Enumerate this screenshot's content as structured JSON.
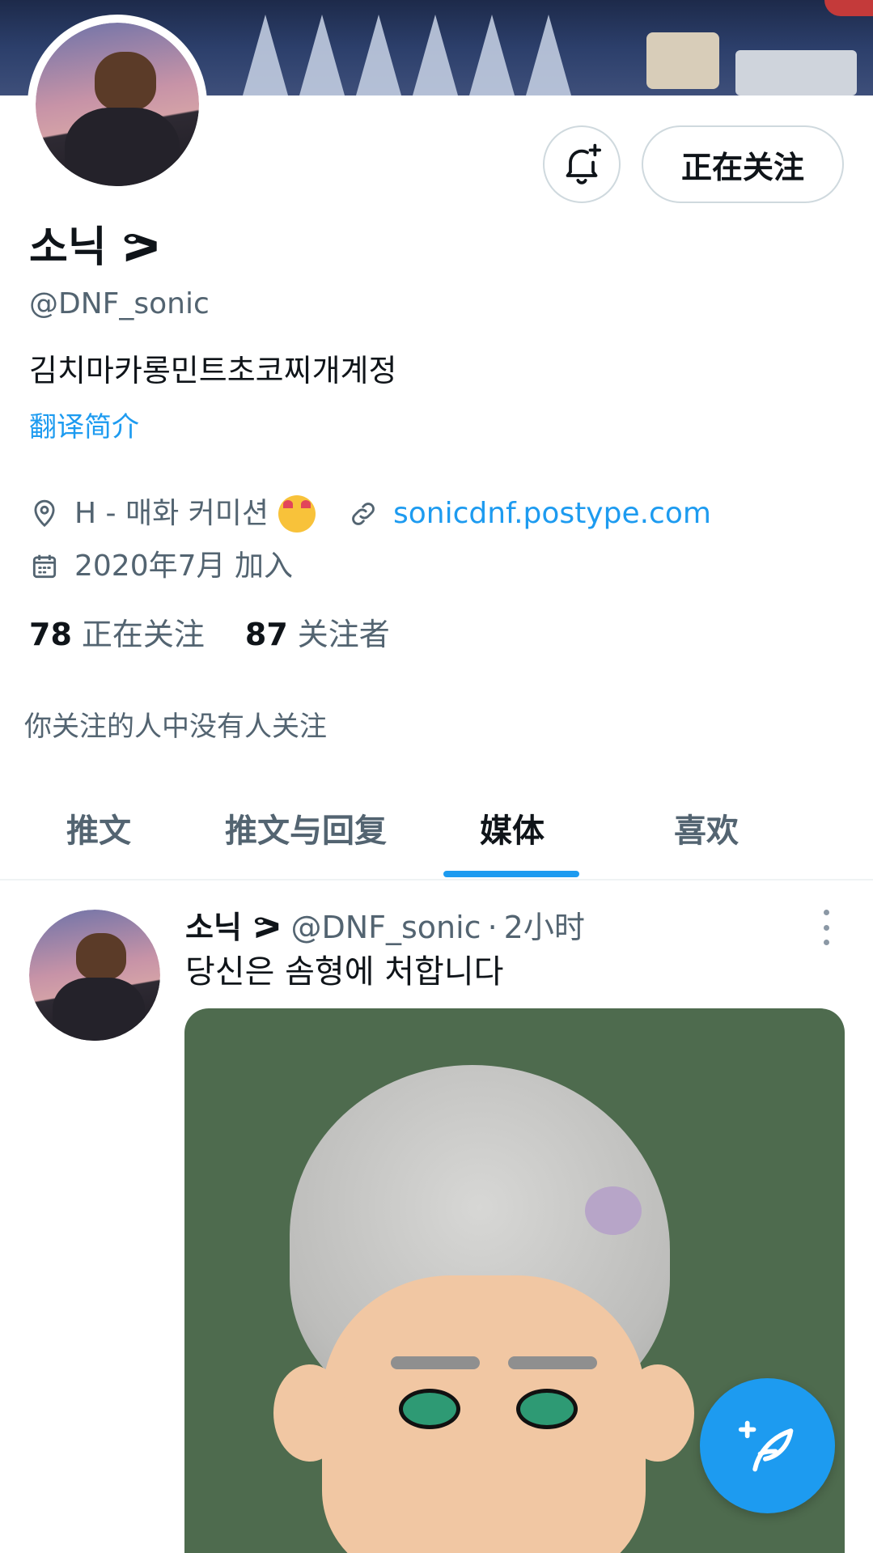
{
  "profile": {
    "display_name": "소닉 ᕗ",
    "handle": "@DNF_sonic",
    "bio": "김치마카롱민트초코찌개계정",
    "translate_label": "翻译简介",
    "location": "H - 매화 커미션",
    "website": "sonicdnf.postype.com",
    "joined": "2020年7月 加入",
    "following_count": "78",
    "following_label": "正在关注",
    "followers_count": "87",
    "followers_label": "关注者",
    "no_common_followers": "你关注的人中没有人关注"
  },
  "actions": {
    "notify_icon": "bell-plus-icon",
    "follow_state_label": "正在关注"
  },
  "tabs": [
    {
      "label": "推文"
    },
    {
      "label": "推文与回复"
    },
    {
      "label": "媒体"
    },
    {
      "label": "喜欢"
    }
  ],
  "active_tab": "媒体",
  "tweet": {
    "author_name": "소닉 ᕗ",
    "author_handle": "@DNF_sonic",
    "separator": "·",
    "time": "2小时",
    "text": "당신은 솜형에 처합니다"
  },
  "fab": {
    "icon": "compose-feather-icon"
  },
  "colors": {
    "accent": "#1d9bf0",
    "text_primary": "#0f1419",
    "text_secondary": "#536471",
    "border": "#cfd9de"
  }
}
